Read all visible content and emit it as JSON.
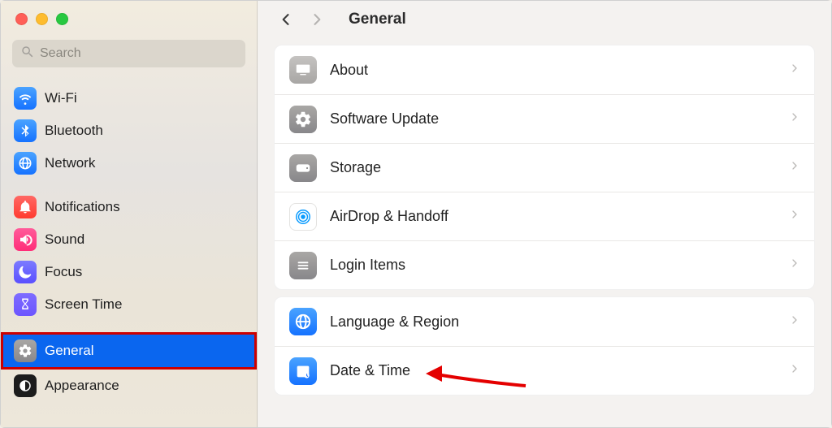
{
  "search": {
    "placeholder": "Search"
  },
  "header": {
    "title": "General"
  },
  "sidebar": {
    "groups": [
      {
        "items": [
          {
            "label": "Wi-Fi"
          },
          {
            "label": "Bluetooth"
          },
          {
            "label": "Network"
          }
        ]
      },
      {
        "items": [
          {
            "label": "Notifications"
          },
          {
            "label": "Sound"
          },
          {
            "label": "Focus"
          },
          {
            "label": "Screen Time"
          }
        ]
      },
      {
        "items": [
          {
            "label": "General"
          },
          {
            "label": "Appearance"
          }
        ]
      }
    ]
  },
  "content": {
    "panels": [
      {
        "rows": [
          {
            "label": "About"
          },
          {
            "label": "Software Update"
          },
          {
            "label": "Storage"
          },
          {
            "label": "AirDrop & Handoff"
          },
          {
            "label": "Login Items"
          }
        ]
      },
      {
        "rows": [
          {
            "label": "Language & Region"
          },
          {
            "label": "Date & Time"
          }
        ]
      }
    ]
  }
}
